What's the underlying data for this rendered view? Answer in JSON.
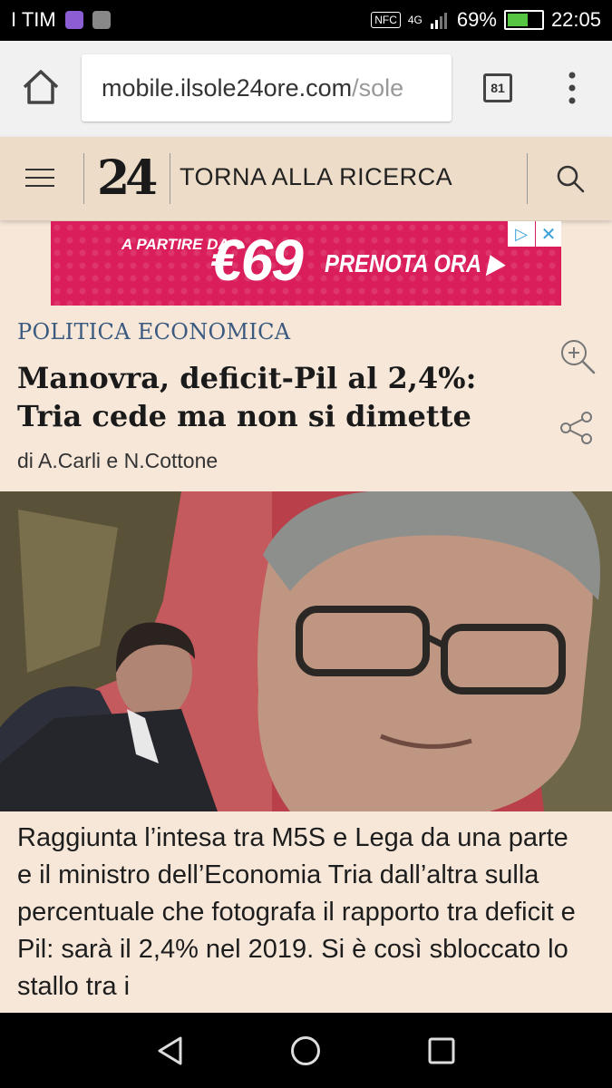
{
  "status_bar": {
    "carrier": "I TIM",
    "nfc": "NFC",
    "network": "4G",
    "battery": "69%",
    "battery_level": 0.69,
    "time": "22:05",
    "battery_color": "#56c542"
  },
  "browser": {
    "url_host": "mobile.ilsole24ore.com",
    "url_path": "/sole",
    "tab_count": "81"
  },
  "site_header": {
    "logo": "24",
    "back_link": "TORNA ALLA RICERCA"
  },
  "ad": {
    "pretext": "A PARTIRE DA",
    "price": "€69",
    "cta": "PRENOTA ORA ▶",
    "adchoices": "▷",
    "close": "✕",
    "bg_color": "#d91e5b"
  },
  "article": {
    "section": "POLITICA ECONOMICA",
    "title": "Manovra, deficit-Pil al 2,4%: Tria cede ma non si dimette",
    "byline": "di A.Carli e N.Cottone",
    "body": "Raggiunta l’intesa tra M5S e Lega da una parte e il ministro dell’Economia Tria dall’altra sulla percentuale che fotografa il rapporto tra deficit e Pil: sarà il 2,4% nel 2019. Si è così sbloccato lo stallo tra i"
  },
  "icons": {
    "zoom": "zoom-in-icon",
    "share": "share-icon",
    "search": "search-icon",
    "menu": "hamburger-menu-icon",
    "home": "home-icon"
  },
  "colors": {
    "page_bg": "#f6e7d9",
    "header_bg": "#eddcc8",
    "section_color": "#3b5a80"
  }
}
